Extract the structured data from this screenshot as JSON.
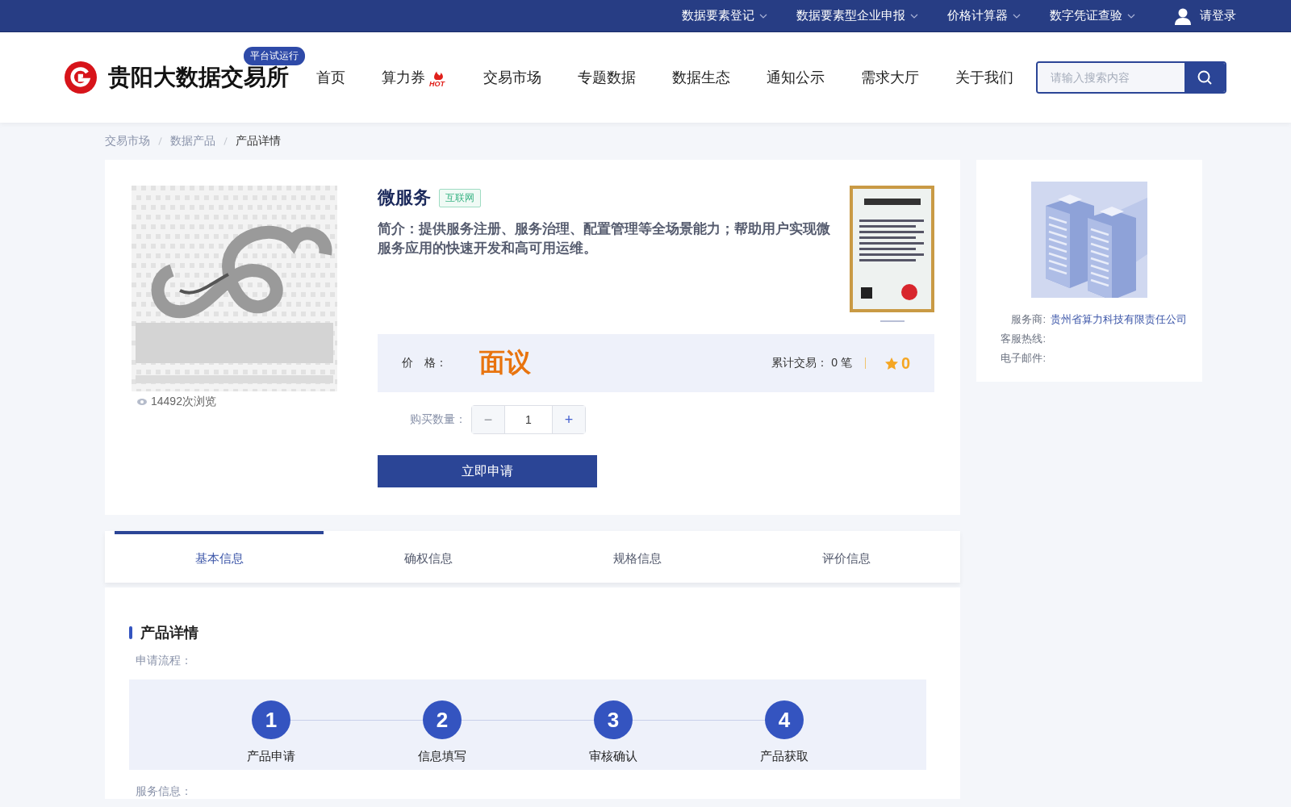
{
  "top_bar": {
    "links": [
      {
        "label": "数据要素登记"
      },
      {
        "label": "数据要素型企业申报"
      },
      {
        "label": "价格计算器"
      },
      {
        "label": "数字凭证查验"
      }
    ],
    "login": "请登录"
  },
  "header": {
    "logo": "贵阳大数据交易所",
    "badge": "平台试运行",
    "nav": [
      {
        "label": "首页"
      },
      {
        "label": "算力券",
        "badge": "HOT"
      },
      {
        "label": "交易市场"
      },
      {
        "label": "专题数据"
      },
      {
        "label": "数据生态"
      },
      {
        "label": "通知公示"
      },
      {
        "label": "需求大厅"
      },
      {
        "label": "关于我们"
      }
    ],
    "search": {
      "placeholder": "请输入搜索内容"
    }
  },
  "breadcrumb": [
    {
      "label": "交易市场",
      "current": false
    },
    {
      "label": "数据产品",
      "current": false
    },
    {
      "label": "产品详情",
      "current": true
    }
  ],
  "product": {
    "views": "14492次浏览",
    "title": "微服务",
    "tag": "互联网",
    "intro": "简介：提供服务注册、服务治理、配置管理等全场景能力；帮助用户实现微服务应用的快速开发和高可用运维。",
    "price_label": "价　格：",
    "price": "面议",
    "trades": "累计交易： 0 笔",
    "rating": "0",
    "quantity_label": "购买数量：",
    "minus": "−",
    "quantity": "1",
    "plus": "+",
    "apply_button": "立即申请"
  },
  "vendor": {
    "fields": [
      {
        "label": "服务商:",
        "value": "贵州省算力科技有限责任公司"
      },
      {
        "label": "客服热线:"
      },
      {
        "label": "电子邮件:"
      }
    ]
  },
  "tabs": [
    {
      "label": "基本信息",
      "selected": true
    },
    {
      "label": "确权信息",
      "selected": false
    },
    {
      "label": "规格信息",
      "selected": false
    },
    {
      "label": "评价信息",
      "selected": false
    }
  ],
  "details": {
    "title": "产品详情",
    "flow_label": "申请流程：",
    "steps": [
      {
        "number": "1",
        "label": "产品申请"
      },
      {
        "number": "2",
        "label": "信息填写"
      },
      {
        "number": "3",
        "label": "审核确认"
      },
      {
        "number": "4",
        "label": "产品获取"
      }
    ],
    "service_label": "服务信息："
  }
}
